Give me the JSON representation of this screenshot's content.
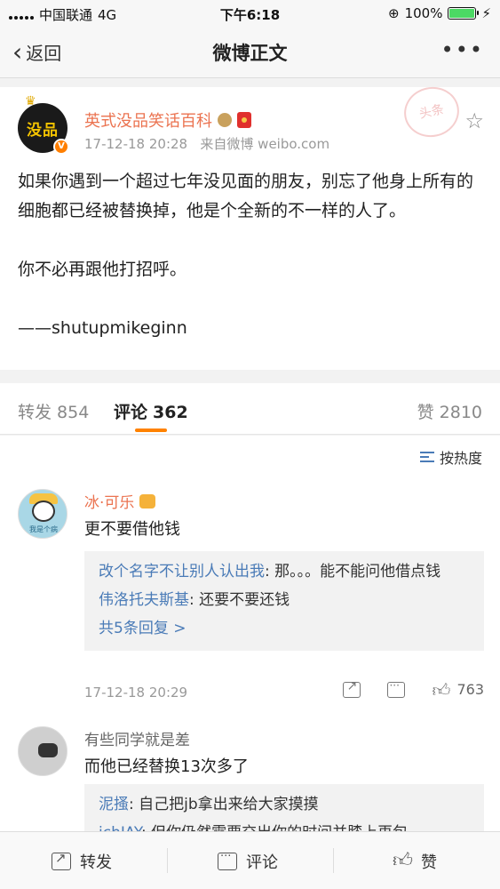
{
  "status_bar": {
    "carrier": "中国联通",
    "network": "4G",
    "time": "下午6:18",
    "battery_text": "100%",
    "battery_level": 1.0
  },
  "nav": {
    "back_label": "返回",
    "title": "微博正文",
    "more": "•••"
  },
  "post": {
    "author": "英式没品笑话百科",
    "avatar_text": "没品",
    "time": "17-12-18 20:28",
    "source": "来自微博 weibo.com",
    "stamp_text": "头条",
    "paragraphs": [
      "如果你遇到一个超过七年没见面的朋友，别忘了他身上所有的细胞都已经被替换掉，他是个全新的不一样的人了。",
      "你不必再跟他打招呼。",
      "——shutupmikeginn"
    ]
  },
  "tabs": {
    "repost_label": "转发",
    "repost_count": "854",
    "comment_label": "评论",
    "comment_count": "362",
    "like_label": "赞",
    "like_count": "2810"
  },
  "comments": {
    "sort_label": "按热度",
    "items": [
      {
        "name": "冰·可乐",
        "avatar_caption": "我是个病",
        "text": "更不要借他钱",
        "replies": [
          {
            "user": "改个名字不让别人认出我",
            "text": ": 那。。。能不能问他借点钱"
          },
          {
            "user": "伟洛托夫斯基",
            "text": ": 还要不要还钱"
          }
        ],
        "more_replies": "共5条回复 >",
        "time": "17-12-18 20:29",
        "likes": "763"
      },
      {
        "name": "有些同学就是差",
        "text": "而他已经替换13次多了",
        "replies": [
          {
            "user": "泥搔",
            "text": ": 自己把jb拿出来给大家摸摸"
          },
          {
            "user": "jchJAY",
            "text": ": 但你仍然需要交出你的时间并膝上再包"
          }
        ]
      }
    ]
  },
  "bottom_bar": {
    "repost": "转发",
    "comment": "评论",
    "like": "赞"
  },
  "colors": {
    "accent_orange": "#ff8200",
    "name_orange": "#eb7350",
    "link_blue": "#4a7bb7"
  }
}
